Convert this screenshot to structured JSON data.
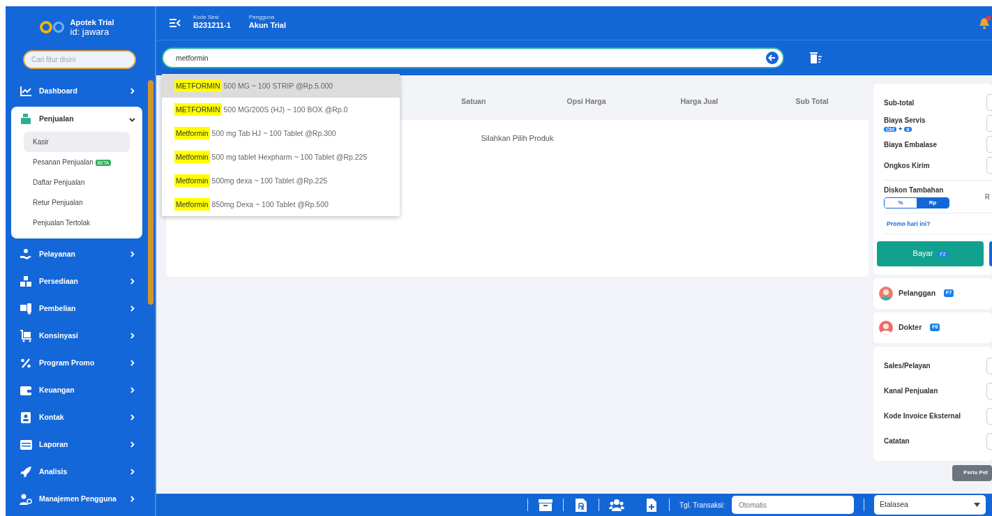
{
  "sidebar": {
    "brand": {
      "name": "Apotek Trial",
      "account": "id: jawara"
    },
    "search": {
      "placeholder": "Cari fitur disini"
    },
    "items": [
      {
        "label": "Dashboard",
        "expanded": false
      },
      {
        "label": "Penjualan",
        "expanded": true,
        "children": [
          {
            "label": "Kasir",
            "selected": true
          },
          {
            "label": "Pesanan Penjualan",
            "badge": "BETA",
            "selected": false
          },
          {
            "label": "Daftar Penjualan",
            "selected": false
          },
          {
            "label": "Retur Penjualan",
            "selected": false
          },
          {
            "label": "Penjualan Tertolak",
            "selected": false
          }
        ]
      },
      {
        "label": "Pelayanan",
        "expanded": false
      },
      {
        "label": "Persediaan",
        "expanded": false
      },
      {
        "label": "Pembelian",
        "expanded": false
      },
      {
        "label": "Konsinyasi",
        "expanded": false
      },
      {
        "label": "Program Promo",
        "expanded": false
      },
      {
        "label": "Keuangan",
        "expanded": false
      },
      {
        "label": "Kontak",
        "expanded": false
      },
      {
        "label": "Laporan",
        "expanded": false
      },
      {
        "label": "Analisis",
        "expanded": false
      },
      {
        "label": "Manajemen Pengguna",
        "expanded": false
      }
    ]
  },
  "header": {
    "session_label": "Kode Sesi",
    "session": "B231211-1",
    "user_label": "Pengguna",
    "user": "Akun Trial",
    "has_notification": true
  },
  "search": {
    "value": "metformin"
  },
  "suggestions": [
    {
      "match": "METFORMIN",
      "rest": "500 MG ~ 100 STRIP @Rp.5.000",
      "selected": true
    },
    {
      "match": "METFORMIN",
      "rest": "500 MG/200S (HJ) ~ 100 BOX @Rp.0",
      "selected": false
    },
    {
      "match": "Metformin",
      "rest": "500 mg Tab HJ ~ 100 Tablet @Rp.300",
      "selected": false
    },
    {
      "match": "Metformin",
      "rest": "500 mg tablet Hexpharm ~ 100 Tablet @Rp.225",
      "selected": false
    },
    {
      "match": "Metformin",
      "rest": "500mg dexa ~ 100 Tablet @Rp.225",
      "selected": false
    },
    {
      "match": "Metformin",
      "rest": "850mg Dexa ~ 100 Tablet @Rp.500",
      "selected": false
    }
  ],
  "table": {
    "columns": [
      "Satuan",
      "Opsi Harga",
      "Harga Jual",
      "Sub Total"
    ],
    "empty_text": "Silahkan Pilih Produk"
  },
  "summary": {
    "rows": [
      {
        "kind": "input",
        "label": "Sub-total"
      },
      {
        "kind": "input",
        "label": "Biaya Servis",
        "shortcut": [
          "Ctrl",
          "d"
        ],
        "joiner": "+"
      },
      {
        "kind": "input",
        "label": "Biaya Embalase"
      },
      {
        "kind": "input",
        "label": "Ongkos Kirim"
      },
      {
        "kind": "discount",
        "label": "Diskon Tambahan",
        "options": [
          {
            "label": "%",
            "selected": false
          },
          {
            "label": "Rp",
            "selected": true
          }
        ],
        "value_text": "R"
      }
    ],
    "promo_link": "Promo hari ini?",
    "pay_button": {
      "label": "Bayar",
      "key": "F2"
    }
  },
  "parties": [
    {
      "label": "Pelanggan",
      "key": "F7"
    },
    {
      "label": "Dokter",
      "key": "F8"
    }
  ],
  "details": [
    "Sales/Pelayan",
    "Kanal Penjualan",
    "Kode Invoice Eksternal",
    "Catatan"
  ],
  "help_button": "Perlu Pet",
  "footer": {
    "date_label": "Tgl. Transaksi:",
    "date_placeholder": "Otomatis",
    "display": "Etalasea"
  }
}
